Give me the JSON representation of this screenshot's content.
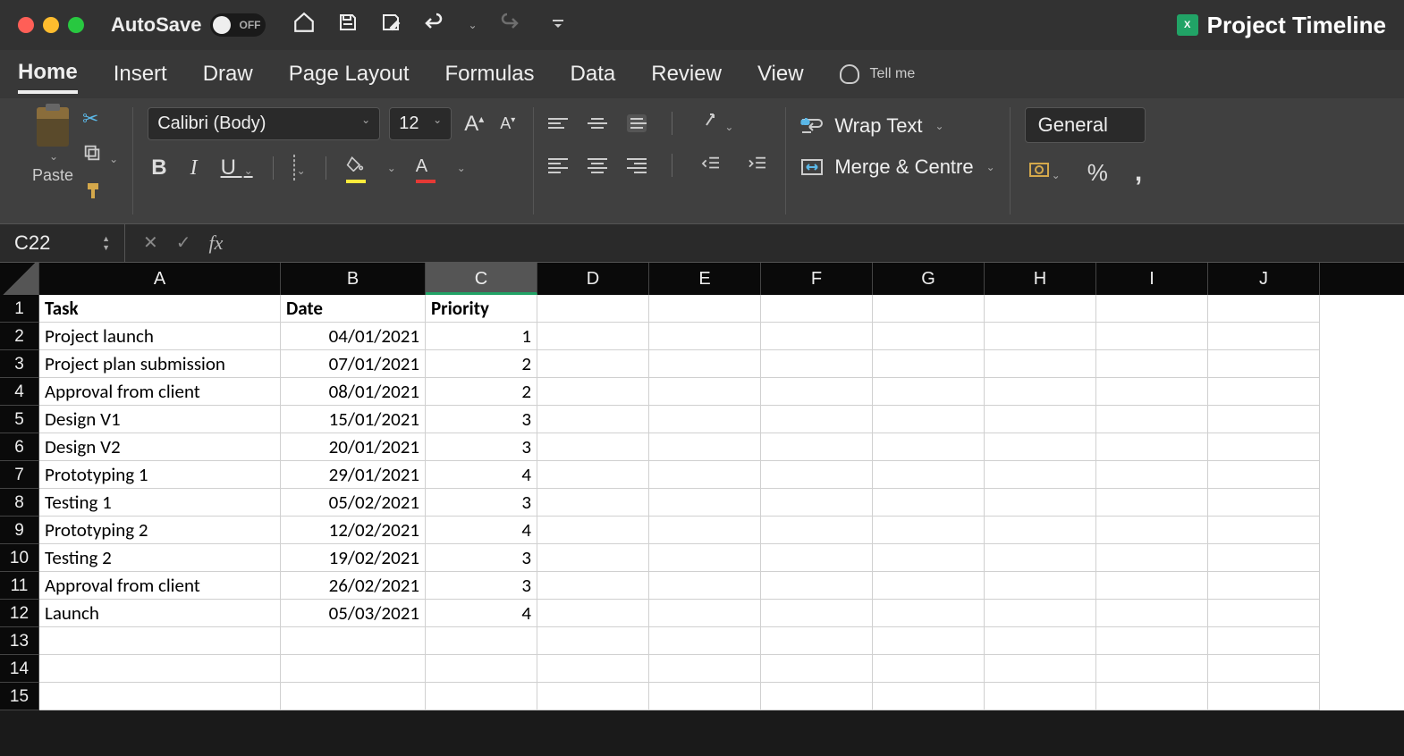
{
  "titlebar": {
    "autosave_label": "AutoSave",
    "autosave_state": "OFF",
    "doc_title": "Project Timeline"
  },
  "tabs": [
    "Home",
    "Insert",
    "Draw",
    "Page Layout",
    "Formulas",
    "Data",
    "Review",
    "View"
  ],
  "tellme": "Tell me",
  "ribbon": {
    "paste_label": "Paste",
    "font_name": "Calibri (Body)",
    "font_size": "12",
    "wrap_text": "Wrap Text",
    "merge_centre": "Merge & Centre",
    "number_format": "General"
  },
  "formula_bar": {
    "name_box": "C22",
    "formula": ""
  },
  "columns": [
    "A",
    "B",
    "C",
    "D",
    "E",
    "F",
    "G",
    "H",
    "I",
    "J"
  ],
  "selected_column": "C",
  "headers": {
    "task": "Task",
    "date": "Date",
    "priority": "Priority"
  },
  "rows": [
    {
      "task": "Project launch",
      "date": "04/01/2021",
      "priority": "1"
    },
    {
      "task": "Project plan submission",
      "date": "07/01/2021",
      "priority": "2"
    },
    {
      "task": "Approval from client",
      "date": "08/01/2021",
      "priority": "2"
    },
    {
      "task": "Design V1",
      "date": "15/01/2021",
      "priority": "3"
    },
    {
      "task": "Design V2",
      "date": "20/01/2021",
      "priority": "3"
    },
    {
      "task": "Prototyping 1",
      "date": "29/01/2021",
      "priority": "4"
    },
    {
      "task": "Testing 1",
      "date": "05/02/2021",
      "priority": "3"
    },
    {
      "task": "Prototyping 2",
      "date": "12/02/2021",
      "priority": "4"
    },
    {
      "task": "Testing 2",
      "date": "19/02/2021",
      "priority": "3"
    },
    {
      "task": "Approval from client",
      "date": "26/02/2021",
      "priority": "3"
    },
    {
      "task": "Launch",
      "date": "05/03/2021",
      "priority": "4"
    }
  ],
  "visible_row_count": 15
}
